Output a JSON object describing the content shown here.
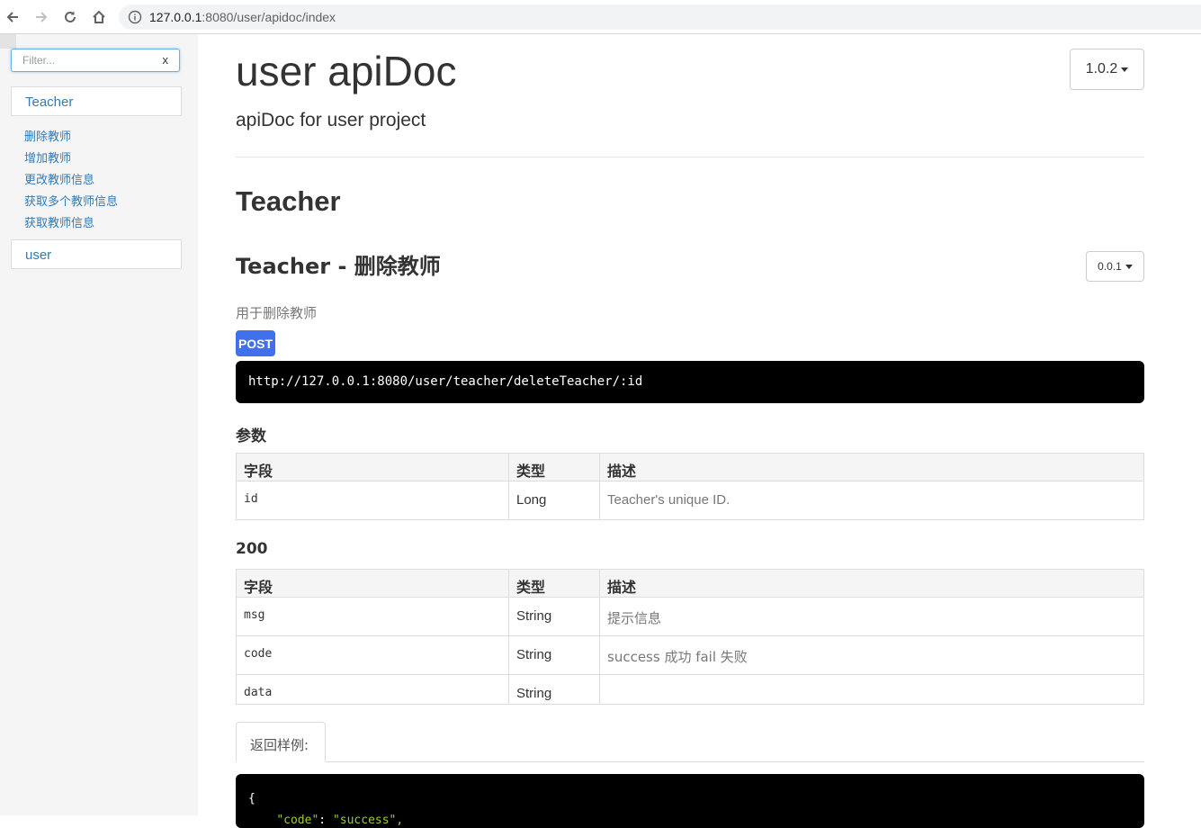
{
  "browser": {
    "url_host": "127.0.0.1",
    "url_rest": ":8080/user/apidoc/index"
  },
  "sidebar": {
    "filter_placeholder": "Filter...",
    "filter_clear": "x",
    "groups": [
      {
        "label": "Teacher",
        "items": [
          "删除教师",
          "增加教师",
          "更改教师信息",
          "获取多个教师信息",
          "获取教师信息"
        ]
      },
      {
        "label": "user",
        "items": []
      }
    ]
  },
  "header": {
    "title": "user apiDoc",
    "subtitle": "apiDoc for user project",
    "version": "1.0.2"
  },
  "section": {
    "group_title": "Teacher",
    "api": {
      "title": "Teacher - 删除教师",
      "version": "0.0.1",
      "description": "用于删除教师",
      "method": "POST",
      "url": "http://127.0.0.1:8080/user/teacher/deleteTeacher/:id",
      "params_title": "参数",
      "table_headers": [
        "字段",
        "类型",
        "描述"
      ],
      "params": [
        {
          "field": "id",
          "type": "Long",
          "desc": "Teacher's unique ID."
        }
      ],
      "success_title": "200",
      "success": [
        {
          "field": "msg",
          "type": "String",
          "desc": "提示信息"
        },
        {
          "field": "code",
          "type": "String",
          "desc": "success 成功 fail 失败"
        },
        {
          "field": "data",
          "type": "String",
          "desc": ""
        }
      ],
      "example_tab": "返回样例:",
      "example_line1": "{",
      "example_key": "\"code\"",
      "example_sep": ": ",
      "example_val": "\"success\","
    }
  }
}
